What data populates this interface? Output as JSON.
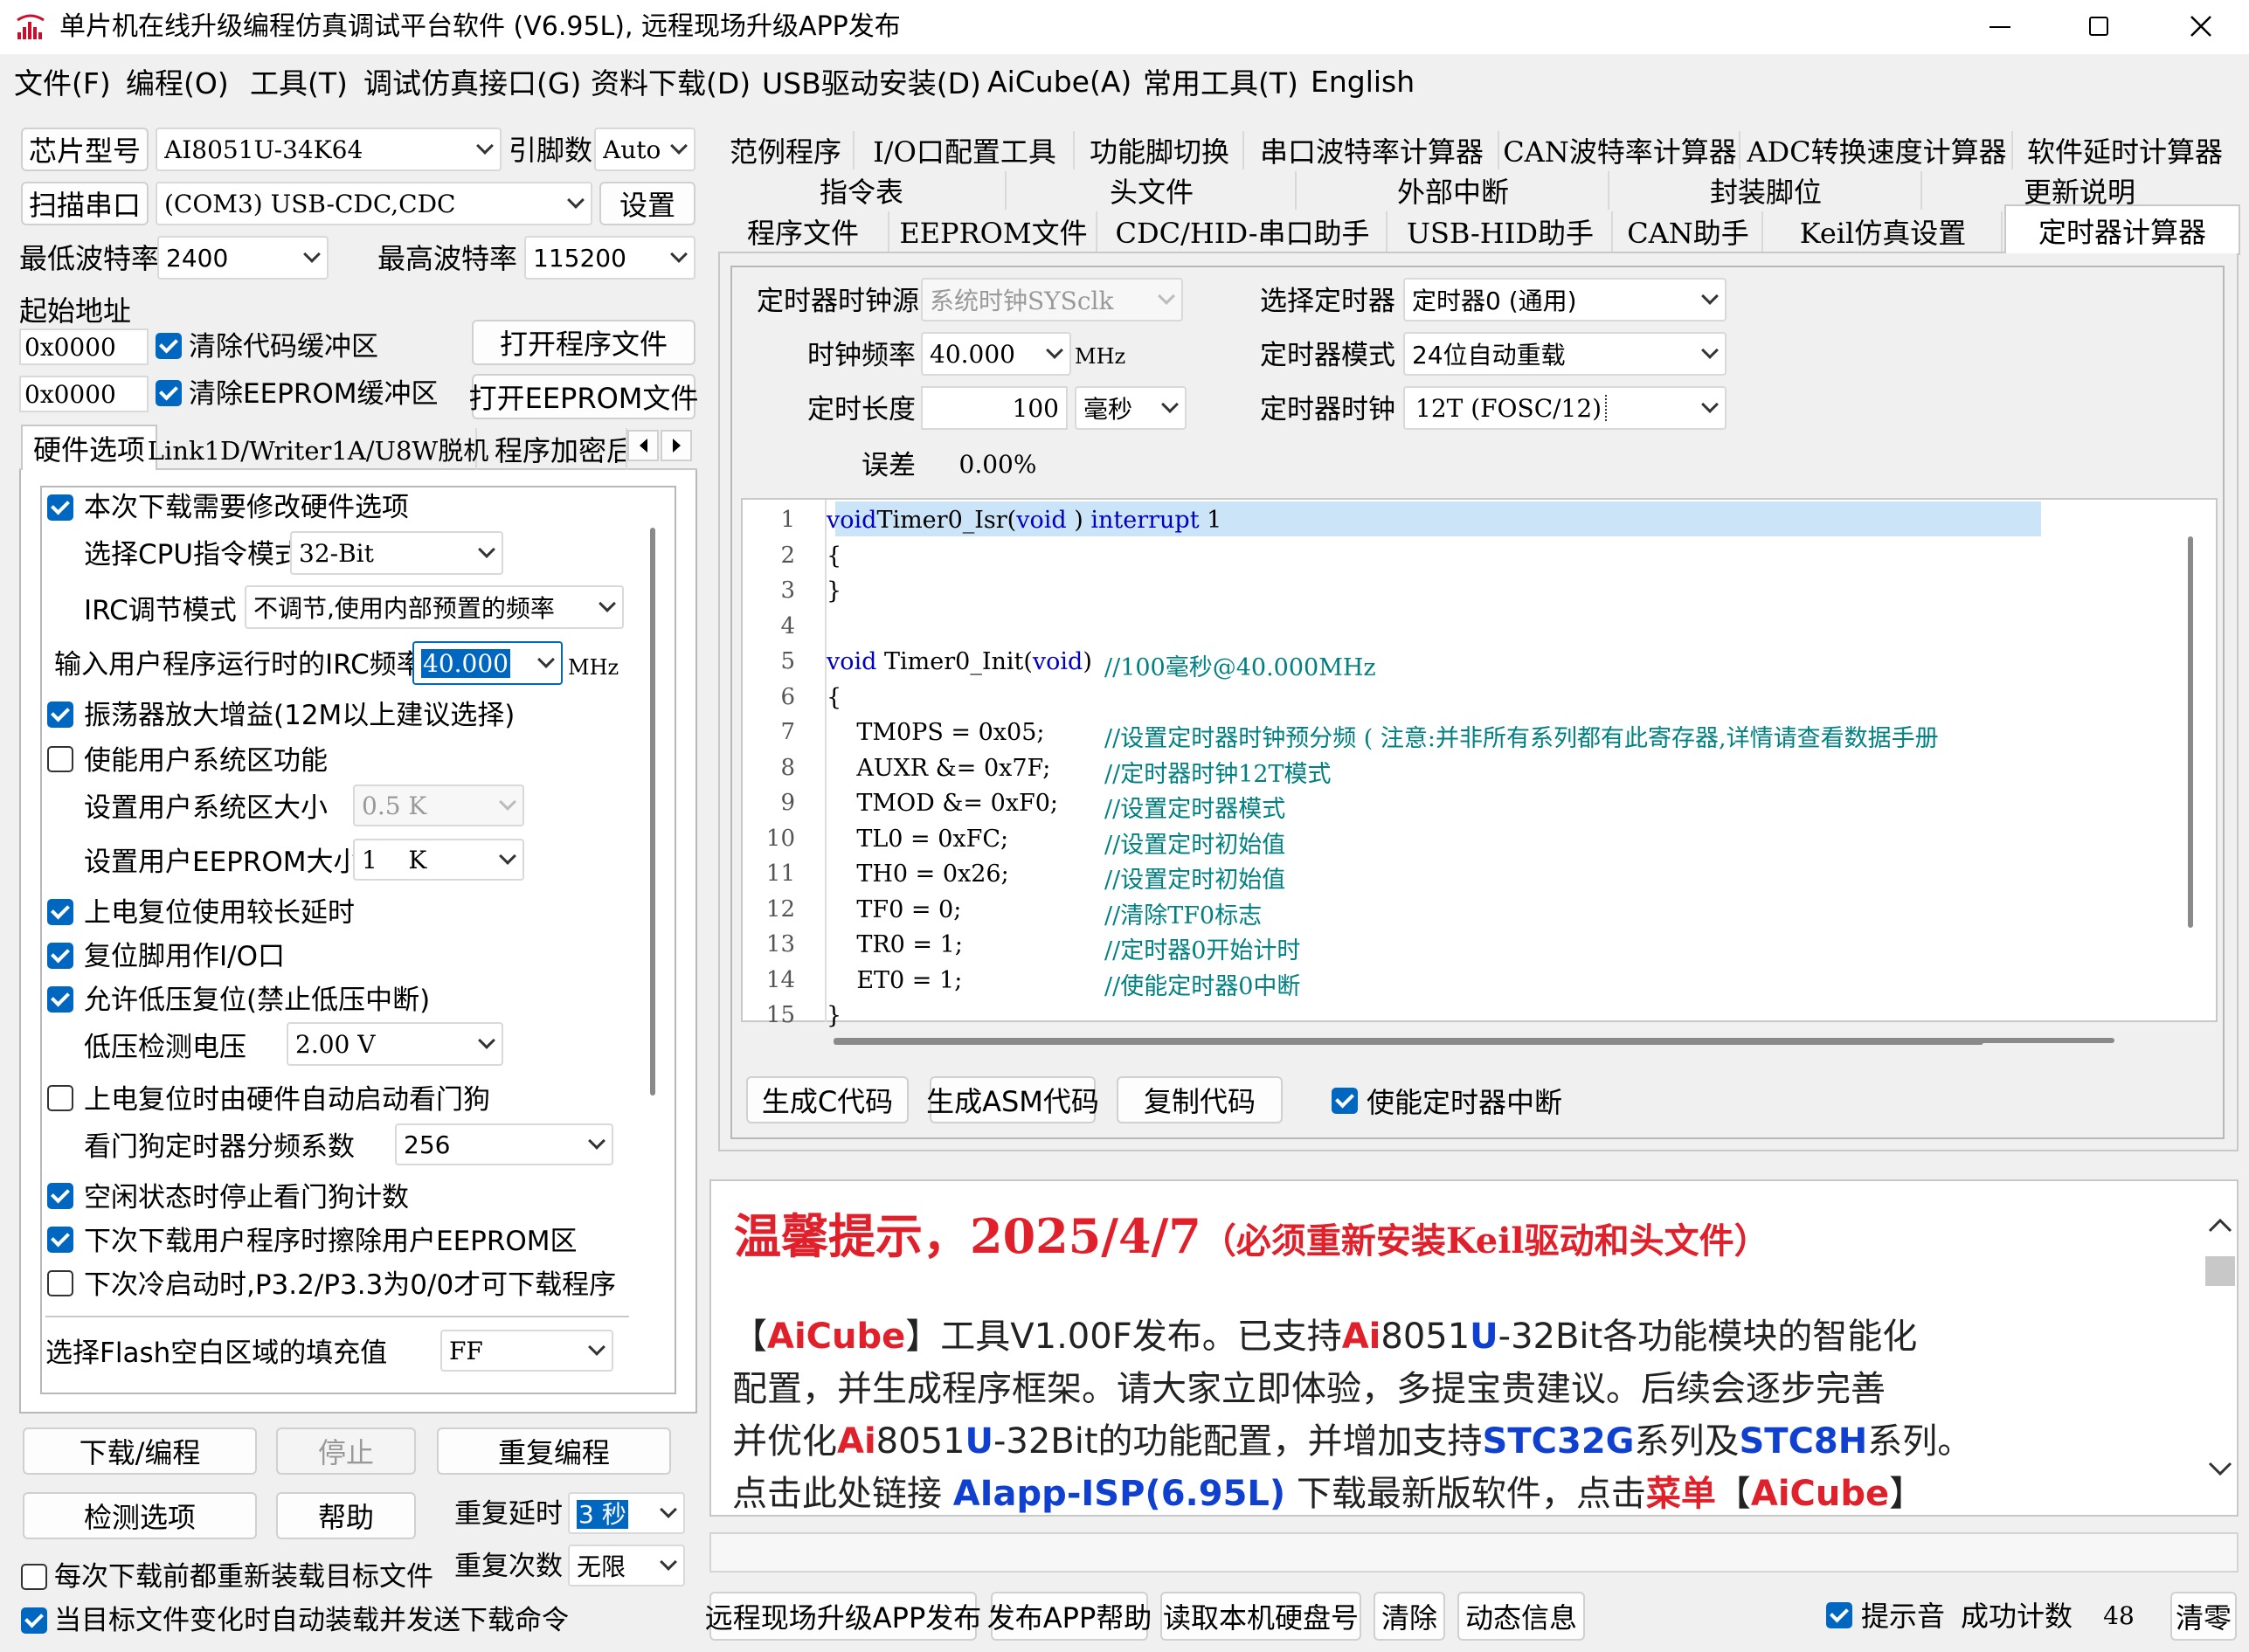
{
  "window": {
    "title": "单片机在线升级编程仿真调试平台软件 (V6.95L), 远程现场升级APP发布",
    "min_icon": "minimize-icon",
    "max_icon": "maximize-icon",
    "close_icon": "close-icon",
    "app_icon": "app-logo-icon",
    "accent": "#0067c0"
  },
  "menu": [
    "文件(F)",
    "编程(O)",
    "工具(T)",
    "调试仿真接口(G)",
    "资料下载(D)",
    "USB驱动安装(D)",
    "AiCube(A)",
    "常用工具(T)",
    "English"
  ],
  "left": {
    "chip_btn": "芯片型号",
    "chip_value": "AI8051U-34K64",
    "pins_label": "引脚数",
    "pins_value": "Auto",
    "scan_btn": "扫描串口",
    "port_value": "(COM3) USB-CDC,CDC",
    "settings_btn": "设置",
    "min_baud_label": "最低波特率",
    "min_baud": "2400",
    "max_baud_label": "最高波特率",
    "max_baud": "115200",
    "start_addr_label": "起始地址",
    "addr1": "0x0000",
    "clear_code": "清除代码缓冲区",
    "open_prog": "打开程序文件",
    "addr2": "0x0000",
    "clear_eeprom": "清除EEPROM缓冲区",
    "open_eeprom": "打开EEPROM文件",
    "tabs": [
      "硬件选项",
      "Link1D/Writer1A/U8W脱机",
      "程序加密后"
    ],
    "hw": {
      "modify_hw": "本次下载需要修改硬件选项",
      "cpu_mode_label": "选择CPU指令模式",
      "cpu_mode": "32-Bit",
      "irc_mode_label": "IRC调节模式",
      "irc_mode": "不调节,使用内部预置的频率",
      "irc_freq_label": "输入用户程序运行时的IRC频率",
      "irc_freq": "40.000",
      "irc_unit": "MHz",
      "osc_gain": "振荡器放大增益(12M以上建议选择)",
      "user_sys": "使能用户系统区功能",
      "sys_size_label": "设置用户系统区大小",
      "sys_size": "0.5 K",
      "eeprom_size_label": "设置用户EEPROM大小",
      "eeprom_size": "1    K",
      "long_delay": "上电复位使用较长延时",
      "reset_io": "复位脚用作I/O口",
      "lvr": "允许低压复位(禁止低压中断)",
      "lvd_label": "低压检测电压",
      "lvd": "2.00 V",
      "wdt_auto": "上电复位时由硬件自动启动看门狗",
      "wdt_div_label": "看门狗定时器分频系数",
      "wdt_div": "256",
      "idle_wdt": "空闲状态时停止看门狗计数",
      "erase_eeprom": "下次下载用户程序时擦除用户EEPROM区",
      "cold_boot": "下次冷启动时,P3.2/P3.3为0/0才可下载程序",
      "fill_label": "选择Flash空白区域的填充值",
      "fill": "FF"
    },
    "download_btn": "下载/编程",
    "stop_btn": "停止",
    "repeat_btn": "重复编程",
    "check_btn": "检测选项",
    "help_btn": "帮助",
    "repeat_delay_label": "重复延时",
    "repeat_delay": "3 秒",
    "repeat_count_label": "重复次数",
    "repeat_count": "无限",
    "reload": "每次下载前都重新装载目标文件",
    "auto_send": "当目标文件变化时自动装载并发送下载命令"
  },
  "right": {
    "tabs_row1": [
      "范例程序",
      "I/O口配置工具",
      "功能脚切换",
      "串口波特率计算器",
      "CAN波特率计算器",
      "ADC转换速度计算器",
      "软件延时计算器"
    ],
    "tabs_row2": [
      "指令表",
      "头文件",
      "外部中断",
      "封装脚位",
      "更新说明"
    ],
    "tabs_row3": [
      "程序文件",
      "EEPROM文件",
      "CDC/HID-串口助手",
      "USB-HID助手",
      "CAN助手",
      "Keil仿真设置",
      "定时器计算器"
    ],
    "timer": {
      "src_label": "定时器时钟源",
      "src": "系统时钟SYSclk",
      "sel_label": "选择定时器",
      "sel": "定时器0 (通用)",
      "freq_label": "时钟频率",
      "freq": "40.000",
      "freq_unit": "MHz",
      "mode_label": "定时器模式",
      "mode": "24位自动重载",
      "len_label": "定时长度",
      "len": "100",
      "len_unit": "毫秒",
      "clk_label": "定时器时钟",
      "clk": "12T (FOSC/12)",
      "err_label": "误差",
      "err": "0.00%"
    },
    "code": [
      {
        "n": "1",
        "parts": [
          [
            "kw",
            "void"
          ],
          [
            "",
            "Timer0_Isr("
          ],
          [
            "kw",
            "void"
          ],
          [
            "",
            " ) "
          ],
          [
            "kw",
            "interrupt"
          ],
          [
            "",
            " 1"
          ]
        ]
      },
      {
        "n": "2",
        "parts": [
          [
            "",
            "{"
          ]
        ]
      },
      {
        "n": "3",
        "parts": [
          [
            "",
            "}"
          ]
        ]
      },
      {
        "n": "4",
        "parts": []
      },
      {
        "n": "5",
        "parts": [
          [
            "kw",
            "void"
          ],
          [
            "",
            " Timer0_Init("
          ],
          [
            "kw",
            "void"
          ],
          [
            "",
            ")"
          ]
        ],
        "comment": "//100毫秒@40.000MHz"
      },
      {
        "n": "6",
        "parts": [
          [
            "",
            "{"
          ]
        ]
      },
      {
        "n": "7",
        "parts": [
          [
            "",
            "    TM0PS = 0x05;"
          ]
        ],
        "comment": "//设置定时器时钟预分频 ( 注意:并非所有系列都有此寄存器,详情请查看数据手册"
      },
      {
        "n": "8",
        "parts": [
          [
            "",
            "    AUXR &= 0x7F;"
          ]
        ],
        "comment": "//定时器时钟12T模式"
      },
      {
        "n": "9",
        "parts": [
          [
            "",
            "    TMOD &= 0xF0;"
          ]
        ],
        "comment": "//设置定时器模式"
      },
      {
        "n": "10",
        "parts": [
          [
            "",
            "    TL0 = 0xFC;"
          ]
        ],
        "comment": "//设置定时初始值"
      },
      {
        "n": "11",
        "parts": [
          [
            "",
            "    TH0 = 0x26;"
          ]
        ],
        "comment": "//设置定时初始值"
      },
      {
        "n": "12",
        "parts": [
          [
            "",
            "    TF0 = 0;"
          ]
        ],
        "comment": "//清除TF0标志"
      },
      {
        "n": "13",
        "parts": [
          [
            "",
            "    TR0 = 1;"
          ]
        ],
        "comment": "//定时器0开始计时"
      },
      {
        "n": "14",
        "parts": [
          [
            "",
            "    ET0 = 1;"
          ]
        ],
        "comment": "//使能定时器0中断"
      },
      {
        "n": "15",
        "parts": [
          [
            "",
            "}"
          ]
        ]
      }
    ],
    "gen_c": "生成C代码",
    "gen_asm": "生成ASM代码",
    "copy_code": "复制代码",
    "enable_int": "使能定时器中断",
    "notice": {
      "title": "温馨提示，2025/4/7",
      "title_note": "（必须重新安装Keil驱动和头文件）",
      "l1": [
        [
          "k",
          "【"
        ],
        [
          "r",
          "AiCube"
        ],
        [
          "k",
          "】工具V1.00F发布。已支持"
        ],
        [
          "r",
          "Ai"
        ],
        [
          "k",
          "8051"
        ],
        [
          "b",
          "U"
        ],
        [
          "k",
          "-32Bit各功能模块的智能化"
        ]
      ],
      "l2": [
        [
          "k",
          "配置，并生成程序框架。请大家立即体验，多提宝贵建议。后续会逐步完善"
        ]
      ],
      "l3": [
        [
          "k",
          "并优化"
        ],
        [
          "r",
          "Ai"
        ],
        [
          "k",
          "8051"
        ],
        [
          "b",
          "U"
        ],
        [
          "k",
          "-32Bit的功能配置，并增加支持"
        ],
        [
          "b",
          "STC32G"
        ],
        [
          "k",
          "系列及"
        ],
        [
          "b",
          "STC8H"
        ],
        [
          "k",
          "系列。"
        ]
      ],
      "l4": [
        [
          "k",
          "点击此处链接 "
        ],
        [
          "b",
          "AIapp-ISP(6.95L)"
        ],
        [
          "k",
          " 下载最新版软件，点击"
        ],
        [
          "r",
          "菜单"
        ],
        [
          "k",
          "【"
        ],
        [
          "r",
          "AiCube"
        ],
        [
          "k",
          "】"
        ]
      ]
    },
    "bottom": {
      "remote_btn": "远程现场升级APP发布",
      "app_help_btn": "发布APP帮助",
      "disk_btn": "读取本机硬盘号",
      "clear_btn": "清除",
      "dyn_btn": "动态信息",
      "sound": "提示音",
      "success_label": "成功计数",
      "success": "48",
      "reset_btn": "清零"
    }
  }
}
